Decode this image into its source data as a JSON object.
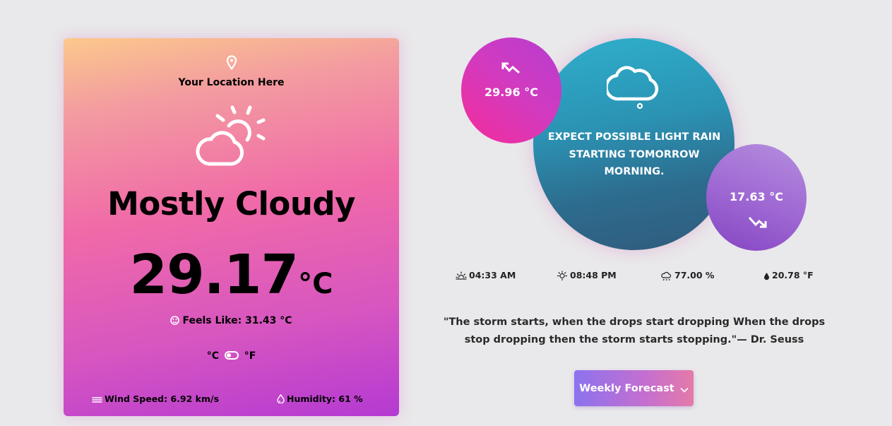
{
  "current": {
    "location": "Your Location Here",
    "condition": "Mostly Cloudy",
    "temperature": "29.17",
    "temp_unit": "°C",
    "feels_like": "Feels Like: 31.43 °C",
    "unit_toggle": {
      "celsius_label": "°C",
      "fahrenheit_label": "°F",
      "selected": "°C"
    },
    "wind": "Wind Speed: 6.92 km/s",
    "humidity": "Humidity: 61 %"
  },
  "forecast": {
    "high": "29.96 °C",
    "low": "17.63 °C",
    "summary": "EXPECT POSSIBLE LIGHT RAIN STARTING TOMORROW MORNING."
  },
  "stats": {
    "sunrise": "04:33 AM",
    "sunset": "08:48 PM",
    "cloud_cover": "77.00 %",
    "dew_point": "20.78 °F"
  },
  "quote": "\"The storm starts, when the drops start dropping When the drops stop dropping then the storm starts stopping.\"— Dr. Seuss",
  "weekly_button_label": "Weekly Forecast",
  "icons": {
    "location": "map-pin-icon",
    "weather": "partly-cloudy-icon",
    "forecast": "thought-cloud-icon",
    "high": "trend-up-icon",
    "low": "trend-down-icon",
    "feels": "thermometer-face-icon",
    "wind": "wind-icon",
    "humidity": "droplet-icon",
    "sunrise": "sunrise-icon",
    "sunset": "sunset-icon",
    "cloud": "cloud-icon",
    "dew": "drop-icon",
    "chevron": "chevron-down-icon"
  },
  "colors": {
    "card_gradient": [
      "#fbc98c",
      "#f06aa8",
      "#b43ad2"
    ],
    "forecast_bubble": [
      "#2fb0cc",
      "#305b7c"
    ],
    "high_bubble": [
      "#f52c9a",
      "#b63cd0"
    ],
    "low_bubble": [
      "#b58ede",
      "#8545c3"
    ],
    "button_gradient": [
      "#8c72ee",
      "#e57aa8"
    ],
    "background": "#e9e8ea"
  }
}
